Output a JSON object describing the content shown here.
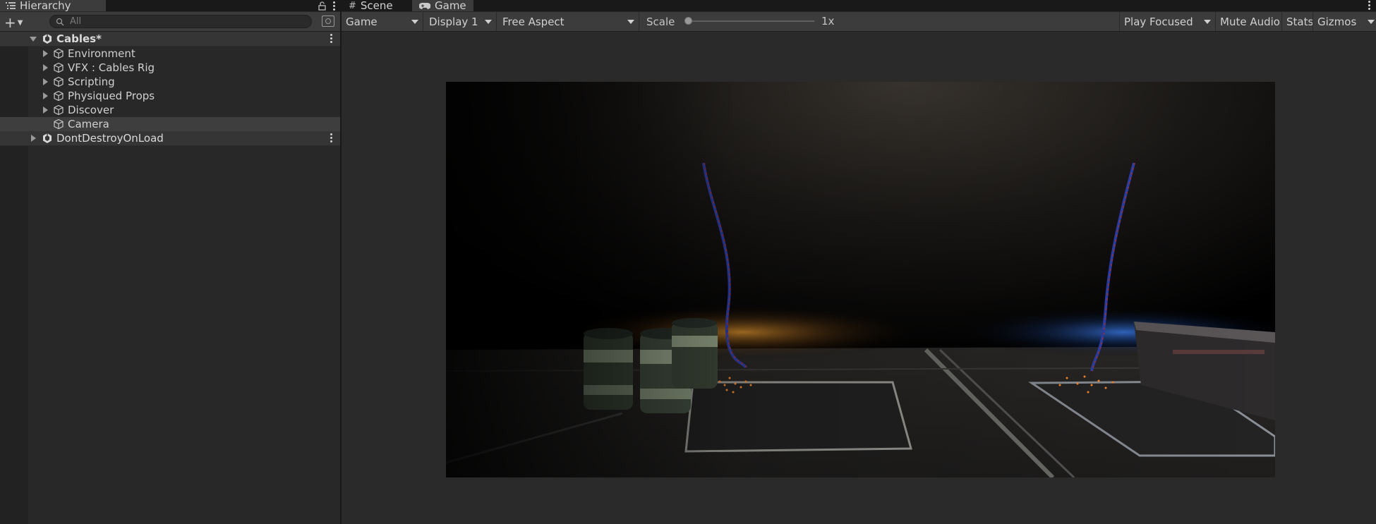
{
  "hierarchy": {
    "title": "Hierarchy",
    "search_placeholder": "All",
    "scene": {
      "name": "Cables*"
    },
    "items": [
      {
        "name": "Environment"
      },
      {
        "name": "VFX : Cables Rig"
      },
      {
        "name": "Scripting"
      },
      {
        "name": "Physiqued Props"
      },
      {
        "name": "Discover"
      },
      {
        "name": "Camera"
      }
    ],
    "ddol": {
      "name": "DontDestroyOnLoad"
    }
  },
  "tabs": {
    "scene": "Scene",
    "game": "Game"
  },
  "toolbar": {
    "view_mode": "Game",
    "display": "Display 1",
    "aspect": "Free Aspect",
    "scale_label": "Scale",
    "scale_value": "1x",
    "play_focused": "Play Focused",
    "mute_audio": "Mute Audio",
    "stats": "Stats",
    "gizmos": "Gizmos"
  },
  "colors": {
    "panel_bg": "#282828",
    "toolbar_bg": "#3c3c3c",
    "warm_light": "#d9882c",
    "cool_light": "#2f6fd9"
  }
}
